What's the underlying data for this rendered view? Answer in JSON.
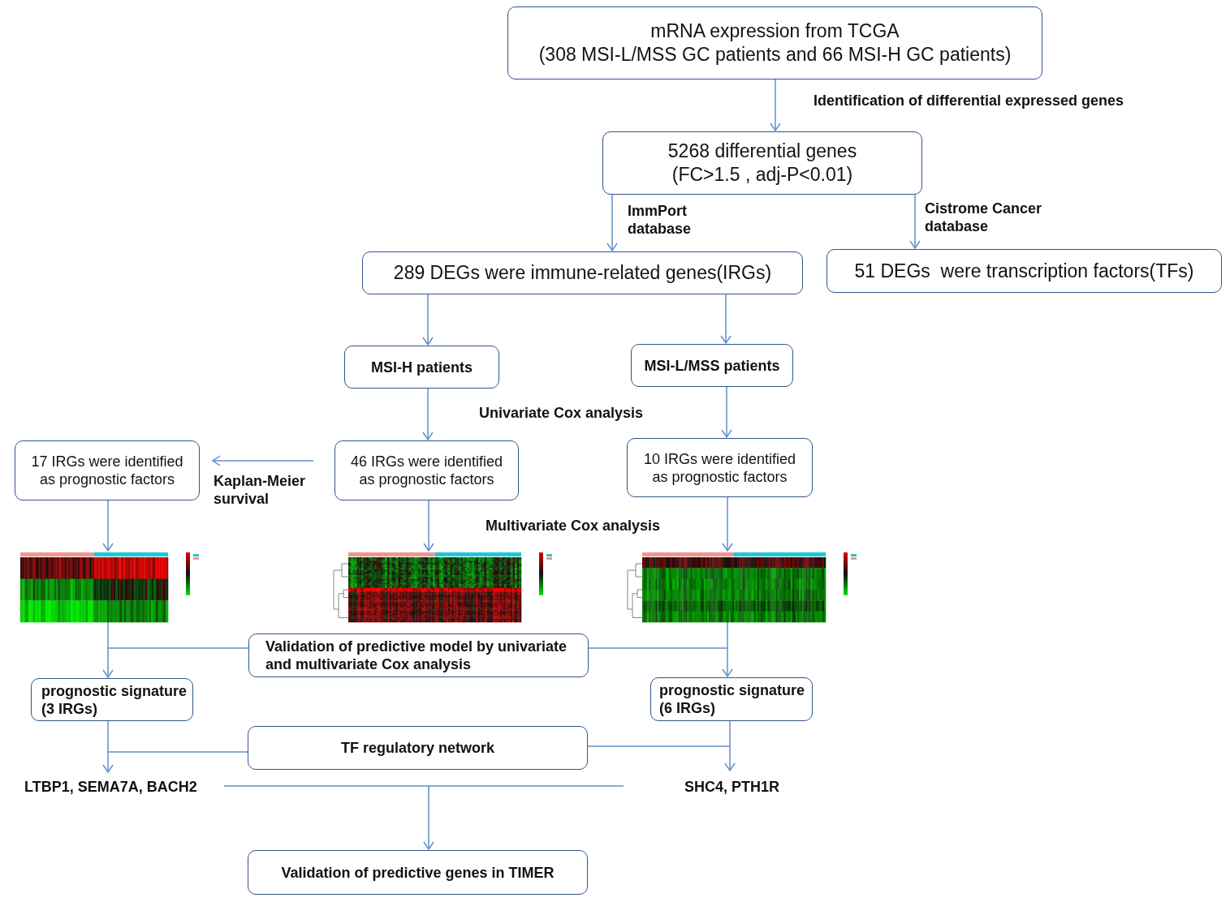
{
  "flowchart": {
    "nodes": [
      {
        "kind": "box",
        "lines": [
          "mRNA expression from TCGA",
          "(308 MSI-L/MSS GC patients and 66 MSI-H GC patients)"
        ]
      },
      {
        "kind": "label",
        "lines": [
          "Identification of differential expressed genes"
        ]
      },
      {
        "kind": "box",
        "lines": [
          "5268 differential genes",
          "(FC>1.5 , adj-P<0.01)"
        ]
      },
      {
        "kind": "label",
        "lines": [
          "ImmPort",
          "database"
        ]
      },
      {
        "kind": "label",
        "lines": [
          "Cistrome Cancer",
          "database"
        ]
      },
      {
        "kind": "box",
        "lines": [
          "289 DEGs were immune-related genes(IRGs)"
        ]
      },
      {
        "kind": "box",
        "lines": [
          "51 DEGs  were transcription factors(TFs)"
        ]
      },
      {
        "kind": "bold_box",
        "lines": [
          "MSI-H patients"
        ]
      },
      {
        "kind": "bold_box",
        "lines": [
          "MSI-L/MSS patients"
        ]
      },
      {
        "kind": "label",
        "lines": [
          "Univariate Cox analysis"
        ]
      },
      {
        "kind": "small_box",
        "lines": [
          "17 IRGs were identified",
          "as prognostic factors"
        ]
      },
      {
        "kind": "label",
        "lines": [
          "Kaplan-Meier",
          "survival"
        ]
      },
      {
        "kind": "small_box",
        "lines": [
          "46 IRGs were identified",
          "as prognostic factors"
        ]
      },
      {
        "kind": "small_box",
        "lines": [
          "10 IRGs were identified",
          "as prognostic factors"
        ]
      },
      {
        "kind": "label",
        "lines": [
          "Multivariate Cox analysis"
        ]
      },
      {
        "kind": "heatmap"
      },
      {
        "kind": "heatmap"
      },
      {
        "kind": "heatmap"
      },
      {
        "kind": "bold_box",
        "lines": [
          "Validation of predictive model by univariate",
          "and multivariate Cox analysis"
        ]
      },
      {
        "kind": "bold_box",
        "lines": [
          "prognostic signature",
          "(3 IRGs)"
        ]
      },
      {
        "kind": "bold_box",
        "lines": [
          "prognostic signature",
          "(6 IRGs)"
        ]
      },
      {
        "kind": "bold_box",
        "lines": [
          "TF regulatory network"
        ]
      },
      {
        "kind": "genes",
        "lines": [
          "LTBP1, SEMA7A, BACH2"
        ]
      },
      {
        "kind": "genes",
        "lines": [
          "SHC4, PTH1R"
        ]
      },
      {
        "kind": "bold_box",
        "lines": [
          "Validation of predictive genes in TIMER"
        ]
      }
    ]
  }
}
